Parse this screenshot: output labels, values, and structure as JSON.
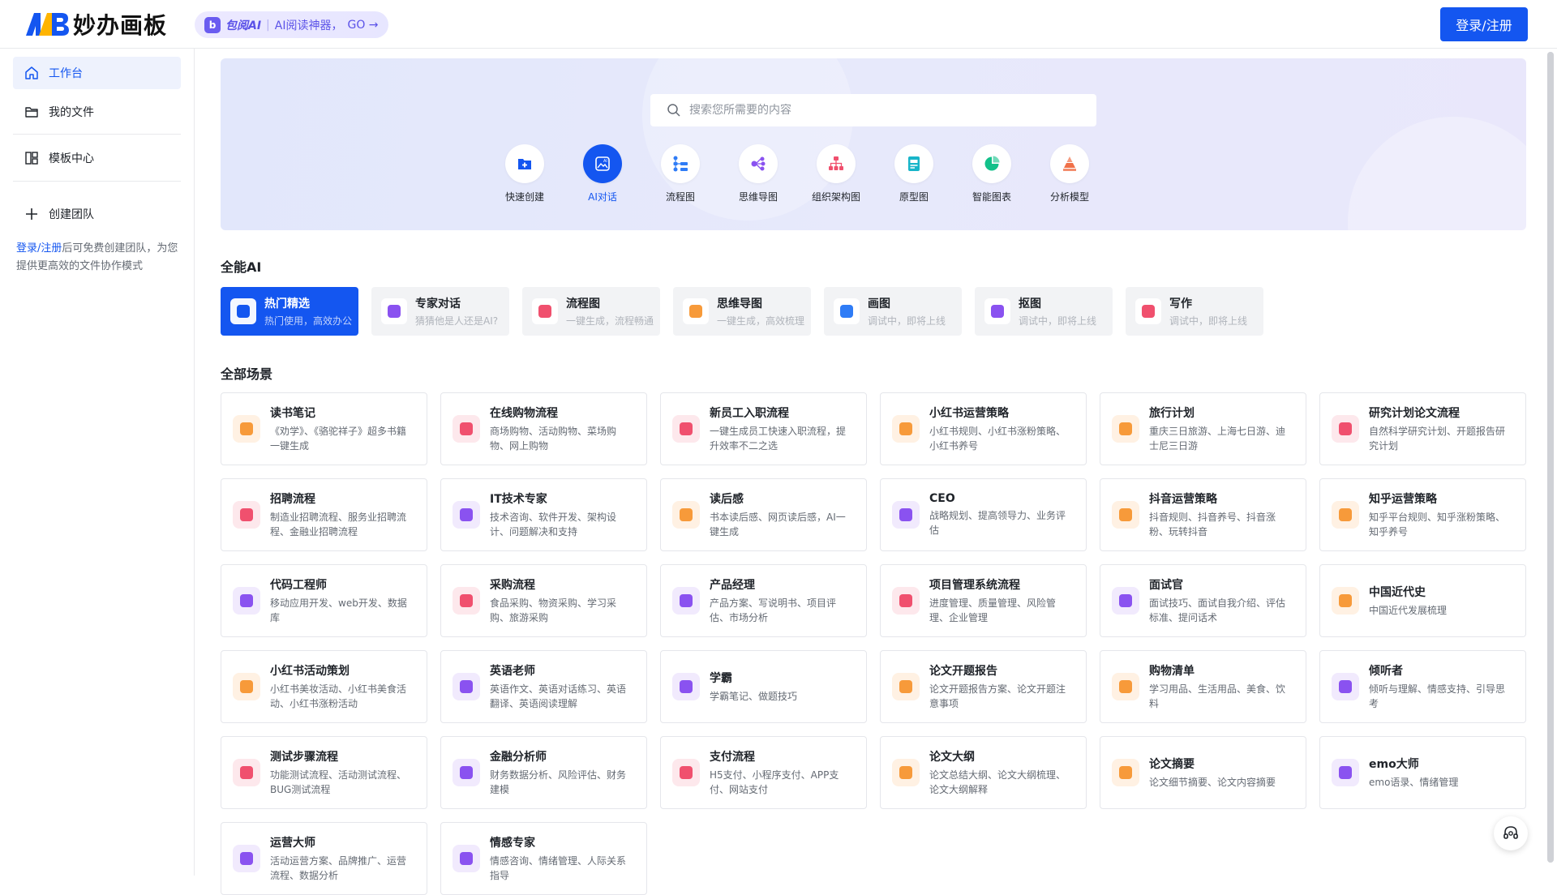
{
  "header": {
    "logo_text": "妙办画板",
    "promo": {
      "brand": "包阅AI",
      "text": "AI阅读神器，",
      "go": "GO →"
    },
    "login_label": "登录/注册"
  },
  "sidebar": {
    "items": [
      {
        "label": "工作台",
        "icon": "home-icon"
      },
      {
        "label": "我的文件",
        "icon": "folder-icon"
      },
      {
        "label": "模板中心",
        "icon": "template-icon"
      },
      {
        "label": "创建团队",
        "icon": "plus-icon"
      }
    ],
    "note_link": "登录/注册",
    "note_text": "后可免费创建团队，为您提供更高效的文件协作模式"
  },
  "banner": {
    "search_placeholder": "搜索您所需要的内容",
    "quick": [
      {
        "label": "快速创建",
        "icon": "folder-plus-icon",
        "color": "#1456f0"
      },
      {
        "label": "AI对话",
        "icon": "ai-chat-icon",
        "color": "#ffffff",
        "active": true
      },
      {
        "label": "流程图",
        "icon": "flowchart-icon",
        "color": "#2f7cf6"
      },
      {
        "label": "思维导图",
        "icon": "mindmap-icon",
        "color": "#8a52f0"
      },
      {
        "label": "组织架构图",
        "icon": "org-chart-icon",
        "color": "#f0506e"
      },
      {
        "label": "原型图",
        "icon": "prototype-icon",
        "color": "#18b5c9"
      },
      {
        "label": "智能图表",
        "icon": "pie-chart-icon",
        "color": "#13c18a"
      },
      {
        "label": "分析模型",
        "icon": "pyramid-icon",
        "color": "#f07048"
      }
    ]
  },
  "ai": {
    "title": "全能AI",
    "tabs": [
      {
        "t1": "热门精选",
        "t2": "热门使用，高效办公",
        "color": "#ffffff",
        "active": true
      },
      {
        "t1": "专家对话",
        "t2": "猜猜他是人还是AI?",
        "color": "#8a52f0"
      },
      {
        "t1": "流程图",
        "t2": "一键生成，流程畅通",
        "color": "#f0506e"
      },
      {
        "t1": "思维导图",
        "t2": "一键生成，高效梳理",
        "color": "#f79a3a"
      },
      {
        "t1": "画图",
        "t2": "调试中，即将上线",
        "color": "#2f7cf6"
      },
      {
        "t1": "抠图",
        "t2": "调试中，即将上线",
        "color": "#8a52f0"
      },
      {
        "t1": "写作",
        "t2": "调试中，即将上线",
        "color": "#f0506e"
      }
    ]
  },
  "scenes": {
    "title": "全部场景",
    "cards": [
      {
        "t1": "读书笔记",
        "t2": "《劝学》、《骆驼祥子》超多书籍一键生成",
        "kind": "mindmap"
      },
      {
        "t1": "在线购物流程",
        "t2": "商场购物、活动购物、菜场购物、网上购物",
        "kind": "flow"
      },
      {
        "t1": "新员工入职流程",
        "t2": "一键生成员工快速入职流程，提升效率不二之选",
        "kind": "flow"
      },
      {
        "t1": "小红书运营策略",
        "t2": "小红书规则、小红书涨粉策略、小红书养号",
        "kind": "mindmap"
      },
      {
        "t1": "旅行计划",
        "t2": "重庆三日旅游、上海七日游、迪士尼三日游",
        "kind": "mindmap"
      },
      {
        "t1": "研究计划论文流程",
        "t2": "自然科学研究计划、开题报告研究计划",
        "kind": "flow"
      },
      {
        "t1": "招聘流程",
        "t2": "制造业招聘流程、服务业招聘流程、金融业招聘流程",
        "kind": "flow"
      },
      {
        "t1": "IT技术专家",
        "t2": "技术咨询、软件开发、架构设计、问题解决和支持",
        "kind": "chat"
      },
      {
        "t1": "读后感",
        "t2": "书本读后感、网页读后感，AI一键生成",
        "kind": "mindmap"
      },
      {
        "t1": "CEO",
        "t2": "战略规划、提高领导力、业务评估",
        "kind": "chat"
      },
      {
        "t1": "抖音运营策略",
        "t2": "抖音规则、抖音养号、抖音涨粉、玩转抖音",
        "kind": "mindmap"
      },
      {
        "t1": "知乎运营策略",
        "t2": "知乎平台规则、知乎涨粉策略、知乎养号",
        "kind": "mindmap"
      },
      {
        "t1": "代码工程师",
        "t2": "移动应用开发、web开发、数据库",
        "kind": "chat"
      },
      {
        "t1": "采购流程",
        "t2": "食品采购、物资采购、学习采购、旅游采购",
        "kind": "flow"
      },
      {
        "t1": "产品经理",
        "t2": "产品方案、写说明书、项目评估、市场分析",
        "kind": "chat"
      },
      {
        "t1": "项目管理系统流程",
        "t2": "进度管理、质量管理、风险管理、企业管理",
        "kind": "flow"
      },
      {
        "t1": "面试官",
        "t2": "面试技巧、面试自我介绍、评估标准、提问话术",
        "kind": "chat"
      },
      {
        "t1": "中国近代史",
        "t2": "中国近代发展梳理",
        "kind": "mindmap"
      },
      {
        "t1": "小红书活动策划",
        "t2": "小红书美妆活动、小红书美食活动、小红书涨粉活动",
        "kind": "mindmap"
      },
      {
        "t1": "英语老师",
        "t2": "英语作文、英语对话练习、英语翻译、英语阅读理解",
        "kind": "chat"
      },
      {
        "t1": "学霸",
        "t2": "学霸笔记、做题技巧",
        "kind": "chat"
      },
      {
        "t1": "论文开题报告",
        "t2": "论文开题报告方案、论文开题注意事项",
        "kind": "mindmap"
      },
      {
        "t1": "购物清单",
        "t2": "学习用品、生活用品、美食、饮料",
        "kind": "mindmap"
      },
      {
        "t1": "倾听者",
        "t2": "倾听与理解、情感支持、引导思考",
        "kind": "chat"
      },
      {
        "t1": "测试步骤流程",
        "t2": "功能测试流程、活动测试流程、BUG测试流程",
        "kind": "flow"
      },
      {
        "t1": "金融分析师",
        "t2": "财务数据分析、风险评估、财务建模",
        "kind": "chat"
      },
      {
        "t1": "支付流程",
        "t2": "H5支付、小程序支付、APP支付、网站支付",
        "kind": "flow"
      },
      {
        "t1": "论文大纲",
        "t2": "论文总结大纲、论文大纲梳理、论文大纲解释",
        "kind": "mindmap"
      },
      {
        "t1": "论文摘要",
        "t2": "论文细节摘要、论文内容摘要",
        "kind": "mindmap"
      },
      {
        "t1": "emo大师",
        "t2": "emo语录、情绪管理",
        "kind": "chat"
      },
      {
        "t1": "运营大师",
        "t2": "活动运营方案、品牌推广、运营流程、数据分析",
        "kind": "chat"
      },
      {
        "t1": "情感专家",
        "t2": "情感咨询、情绪管理、人际关系指导",
        "kind": "chat"
      }
    ]
  },
  "colors": {
    "accent": "#1456f0",
    "mindmap": "#f79a3a",
    "flow": "#f0506e",
    "chat": "#8a52f0"
  }
}
